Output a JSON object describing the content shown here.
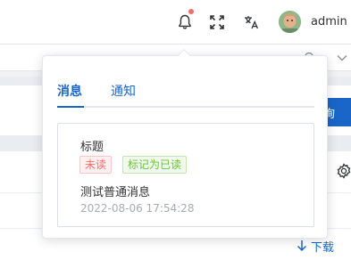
{
  "header": {
    "username": "admin",
    "icons": [
      "bell-icon",
      "fullscreen-icon",
      "language-icon"
    ]
  },
  "background": {
    "query_label": "询",
    "download_label": "下载"
  },
  "popover": {
    "tabs": [
      {
        "label": "消息",
        "active": true
      },
      {
        "label": "通知",
        "active": false
      }
    ],
    "message": {
      "title": "标题",
      "status_badge": "未读",
      "mark_read_label": "标记为已读",
      "content": "测试普通消息",
      "time": "2022-08-06 17:54:28"
    }
  },
  "colors": {
    "primary": "#1966c8",
    "danger": "#f56c6c",
    "success": "#67c23a"
  }
}
